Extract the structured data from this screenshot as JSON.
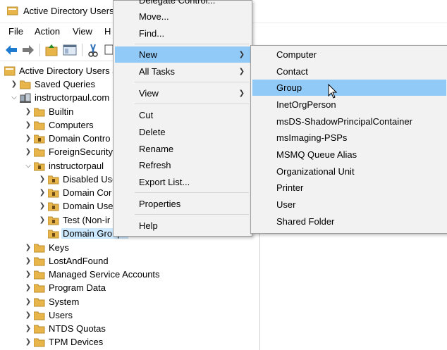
{
  "window": {
    "title": "Active Directory Users"
  },
  "menubar": {
    "items": [
      "File",
      "Action",
      "View",
      "H"
    ]
  },
  "toolbar": {
    "icons": [
      "back-arrow-icon",
      "forward-arrow-icon",
      "up-folder-icon",
      "console-tree-icon",
      "cut-icon",
      "copy-icon"
    ]
  },
  "tree": {
    "root": "Active Directory Users a",
    "saved_queries": "Saved Queries",
    "domain": "instructorpaul.com",
    "domain_children": [
      "Builtin",
      "Computers",
      "Domain Contro",
      "ForeignSecurity",
      "instructorpaul"
    ],
    "ou_children": [
      "Disabled Use",
      "Domain Cor",
      "Domain Use",
      "Test (Non-ir",
      "Domain Groups"
    ],
    "rest": [
      "Keys",
      "LostAndFound",
      "Managed Service Accounts",
      "Program Data",
      "System",
      "Users",
      "NTDS Quotas",
      "TPM Devices"
    ]
  },
  "context_menu": {
    "items": [
      {
        "label": "Delegate Control..."
      },
      {
        "label": "Move..."
      },
      {
        "label": "Find..."
      },
      {
        "label": "New",
        "submenu": true,
        "hot": true
      },
      {
        "label": "All Tasks",
        "submenu": true
      },
      {
        "label": "View",
        "submenu": true
      },
      {
        "label": "Cut"
      },
      {
        "label": "Delete"
      },
      {
        "label": "Rename"
      },
      {
        "label": "Refresh"
      },
      {
        "label": "Export List..."
      },
      {
        "label": "Properties"
      },
      {
        "label": "Help"
      }
    ]
  },
  "new_submenu": {
    "items": [
      "Computer",
      "Contact",
      "Group",
      "InetOrgPerson",
      "msDS-ShadowPrincipalContainer",
      "msImaging-PSPs",
      "MSMQ Queue Alias",
      "Organizational Unit",
      "Printer",
      "User",
      "Shared Folder"
    ],
    "hot": "Group"
  },
  "colors": {
    "highlight": "#91c9f7",
    "selection": "#cce8ff",
    "menu_bg": "#f2f2f2",
    "folder": "#e8b54a"
  }
}
